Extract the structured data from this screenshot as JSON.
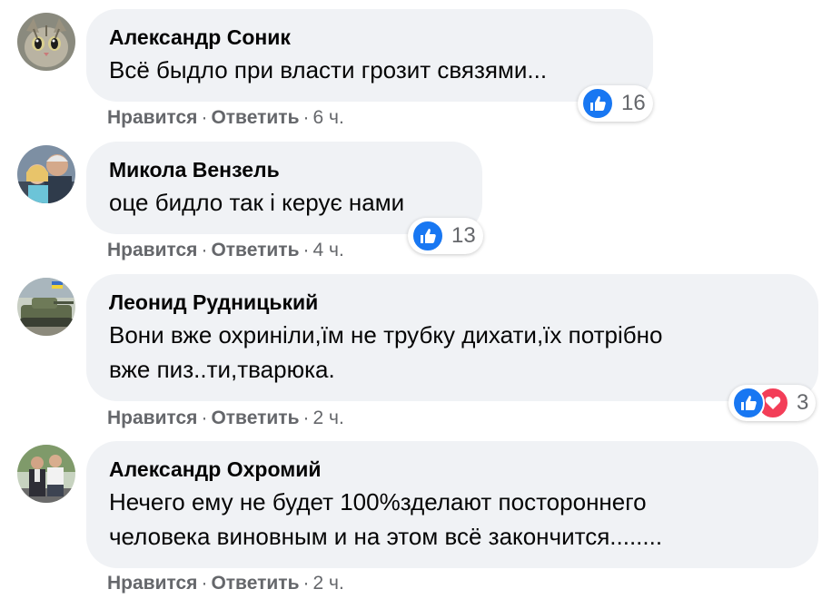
{
  "colors": {
    "bubble": "#f0f2f5",
    "meta_text": "#65676b",
    "like_blue": "#1877f2",
    "love_red": "#f33e58"
  },
  "comments": [
    {
      "author": "Александр Соник",
      "lines": [
        "Всё быдло при власти грозит связями..."
      ],
      "like_label": "Нравится",
      "reply_label": "Ответить",
      "time": "6 ч.",
      "reaction_count": "16",
      "reaction_icons": [
        "like-icon"
      ],
      "avatar_icon": "cat-avatar"
    },
    {
      "author": "Микола Вензель",
      "lines": [
        "оце бидло так і керує нами"
      ],
      "like_label": "Нравится",
      "reply_label": "Ответить",
      "time": "4 ч.",
      "reaction_count": "13",
      "reaction_icons": [
        "like-icon"
      ],
      "avatar_icon": "people-photo-avatar"
    },
    {
      "author": "Леонид Рудницький",
      "lines": [
        "Вони вже охриніли,їм не трубку дихати,їх потрібно",
        "вже пиз..ти,тварюка."
      ],
      "like_label": "Нравится",
      "reply_label": "Ответить",
      "time": "2 ч.",
      "reaction_count": "3",
      "reaction_icons": [
        "like-icon",
        "love-icon"
      ],
      "avatar_icon": "tank-photo-avatar"
    },
    {
      "author": "Александр Охромий",
      "lines": [
        "Нечего ему не будет 100%зделают постороннего",
        "человека виновным и на этом всё закончится........"
      ],
      "like_label": "Нравится",
      "reply_label": "Ответить",
      "time": "2 ч.",
      "reaction_count": null,
      "reaction_icons": [],
      "avatar_icon": "two-men-photo-avatar"
    }
  ]
}
